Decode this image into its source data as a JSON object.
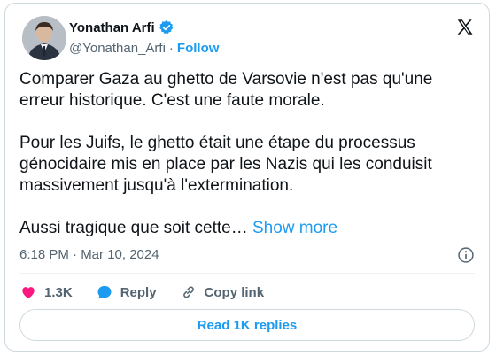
{
  "author": {
    "name": "Yonathan Arfi",
    "handle": "@Yonathan_Arfi",
    "separator": "·",
    "follow_label": "Follow",
    "verified_color": "#1d9bf0"
  },
  "tweet": {
    "paragraphs": [
      "Comparer Gaza au ghetto de Varsovie n'est pas qu'une\nerreur historique. C'est une faute morale.",
      "Pour les Juifs, le ghetto était une étape du processus\ngénocidaire mis en place par les Nazis qui les conduisit\nmassivement jusqu'à l'extermination."
    ],
    "truncated_text": "Aussi tragique que soit cette… ",
    "show_more_label": "Show more",
    "timestamp": "6:18 PM · Mar 10, 2024"
  },
  "actions": {
    "likes": "1.3K",
    "reply_label": "Reply",
    "copy_link_label": "Copy link"
  },
  "read_replies_label": "Read 1K replies",
  "icons": [
    "x-logo-icon",
    "verified-badge-icon",
    "info-icon",
    "heart-icon",
    "reply-bubble-icon",
    "link-icon"
  ],
  "colors": {
    "accent": "#1d9bf0",
    "like": "#f91880",
    "text": "#0f1419",
    "muted": "#536471"
  }
}
